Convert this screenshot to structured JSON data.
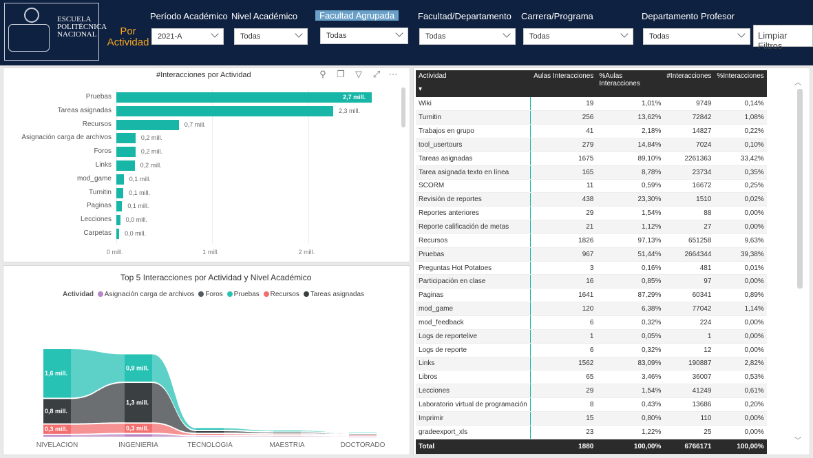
{
  "header": {
    "logo_text": [
      "ESCUELA",
      "POLITÉCNICA",
      "NACIONAL"
    ],
    "page_title": "Por Actividad",
    "filters": [
      {
        "label": "Período Académico",
        "value": "2021-A"
      },
      {
        "label": "Nivel Académico",
        "value": "Todas"
      },
      {
        "label": "Facultad Agrupada",
        "value": "Todas"
      },
      {
        "label": "Facultad/Departamento",
        "value": "Todas"
      },
      {
        "label": "Carrera/Programa",
        "value": "Todas"
      },
      {
        "label": "Departamento Profesor",
        "value": "Todas"
      }
    ],
    "clear_button": "Limpiar Filtros"
  },
  "toolbar_icons": [
    "pin-icon",
    "copy-icon",
    "filter-icon",
    "expand-icon",
    "more-icon"
  ],
  "bar_chart": {
    "title": "#Interacciones por Actividad",
    "x_ticks": [
      "0 mill.",
      "1 mill.",
      "2 mill."
    ]
  },
  "chart_data": [
    {
      "type": "bar",
      "orientation": "horizontal",
      "title": "#Interacciones por Actividad",
      "categories": [
        "Pruebas",
        "Tareas asignadas",
        "Recursos",
        "Asignación carga de archivos",
        "Foros",
        "Links",
        "mod_game",
        "Turnitin",
        "Paginas",
        "Lecciones",
        "Carpetas"
      ],
      "values": [
        2664344,
        2261363,
        651258,
        200000,
        200000,
        190887,
        77042,
        72842,
        60341,
        41249,
        30000
      ],
      "labels": [
        "2,7 mill.",
        "2,3 mill.",
        "0,7 mill.",
        "0,2 mill.",
        "0,2 mill.",
        "0,2 mill.",
        "0,1 mill.",
        "0,1 mill.",
        "0,1 mill.",
        "0,0 mill.",
        "0,0 mill."
      ],
      "xlim": [
        0,
        2900000
      ],
      "color": "#17b6a7"
    },
    {
      "type": "area",
      "title": "Top 5 Interacciones por Actividad y Nivel Académico",
      "legend_title": "Actividad",
      "categories": [
        "NIVELACION",
        "INGENIERIA",
        "TECNOLOGIA",
        "MAESTRIA",
        "DOCTORADO"
      ],
      "series": [
        {
          "name": "Asignación carga de archivos",
          "color": "#b985c4",
          "values": [
            0.05,
            0.08,
            0.01,
            0.01,
            0.0
          ]
        },
        {
          "name": "Foros",
          "color": "#535b5e",
          "values": [
            0.8,
            1.3,
            0.05,
            0.02,
            0.0
          ]
        },
        {
          "name": "Pruebas",
          "color": "#27c2b4",
          "values": [
            1.6,
            0.9,
            0.05,
            0.02,
            0.0
          ]
        },
        {
          "name": "Recursos",
          "color": "#f36e6e",
          "values": [
            0.3,
            0.3,
            0.03,
            0.01,
            0.0
          ]
        },
        {
          "name": "Tareas asignadas",
          "color": "#3a3f42",
          "values": [
            0.8,
            1.3,
            0.05,
            0.02,
            0.0
          ]
        }
      ],
      "data_labels": [
        {
          "text": "1,6 mill.",
          "series": "Pruebas",
          "category": "NIVELACION"
        },
        {
          "text": "0,8 mill.",
          "series": "Tareas asignadas",
          "category": "NIVELACION"
        },
        {
          "text": "0,3 mill.",
          "series": "Recursos",
          "category": "NIVELACION"
        },
        {
          "text": "1,3 mill.",
          "series": "Tareas asignadas",
          "category": "INGENIERIA"
        },
        {
          "text": "0,9 mill.",
          "series": "Pruebas",
          "category": "INGENIERIA"
        },
        {
          "text": "0,3 mill.",
          "series": "Recursos",
          "category": "INGENIERIA"
        }
      ]
    }
  ],
  "table": {
    "columns": [
      "Actividad",
      "Aulas Interacciones",
      "%Aulas Interacciones",
      "#Interacciones",
      "%Interacciones"
    ],
    "rows": [
      [
        "Wiki",
        "19",
        "1,01%",
        "9749",
        "0,14%"
      ],
      [
        "Turnitin",
        "256",
        "13,62%",
        "72842",
        "1,08%"
      ],
      [
        "Trabajos en grupo",
        "41",
        "2,18%",
        "14827",
        "0,22%"
      ],
      [
        "tool_usertours",
        "279",
        "14,84%",
        "7024",
        "0,10%"
      ],
      [
        "Tareas asignadas",
        "1675",
        "89,10%",
        "2261363",
        "33,42%"
      ],
      [
        "Tarea asignada texto en línea",
        "165",
        "8,78%",
        "23734",
        "0,35%"
      ],
      [
        "SCORM",
        "11",
        "0,59%",
        "16672",
        "0,25%"
      ],
      [
        "Revisión de reportes",
        "438",
        "23,30%",
        "1510",
        "0,02%"
      ],
      [
        "Reportes anteriores",
        "29",
        "1,54%",
        "88",
        "0,00%"
      ],
      [
        "Reporte calificación de metas",
        "21",
        "1,12%",
        "27",
        "0,00%"
      ],
      [
        "Recursos",
        "1826",
        "97,13%",
        "651258",
        "9,63%"
      ],
      [
        "Pruebas",
        "967",
        "51,44%",
        "2664344",
        "39,38%"
      ],
      [
        "Preguntas Hot Potatoes",
        "3",
        "0,16%",
        "481",
        "0,01%"
      ],
      [
        "Participación en clase",
        "16",
        "0,85%",
        "97",
        "0,00%"
      ],
      [
        "Paginas",
        "1641",
        "87,29%",
        "60341",
        "0,89%"
      ],
      [
        "mod_game",
        "120",
        "6,38%",
        "77042",
        "1,14%"
      ],
      [
        "mod_feedback",
        "6",
        "0,32%",
        "224",
        "0,00%"
      ],
      [
        "Logs de reportelive",
        "1",
        "0,05%",
        "1",
        "0,00%"
      ],
      [
        "Logs de reporte",
        "6",
        "0,32%",
        "12",
        "0,00%"
      ],
      [
        "Links",
        "1562",
        "83,09%",
        "190887",
        "2,82%"
      ],
      [
        "Libros",
        "65",
        "3,46%",
        "36007",
        "0,53%"
      ],
      [
        "Lecciones",
        "29",
        "1,54%",
        "41249",
        "0,61%"
      ],
      [
        "Laboratorio virtual de programación",
        "8",
        "0,43%",
        "13686",
        "0,20%"
      ],
      [
        "Imprimir",
        "15",
        "0,80%",
        "110",
        "0,00%"
      ],
      [
        "gradeexport_xls",
        "23",
        "1,22%",
        "25",
        "0,00%"
      ]
    ],
    "total": [
      "Total",
      "1880",
      "100,00%",
      "6766171",
      "100,00%"
    ]
  }
}
